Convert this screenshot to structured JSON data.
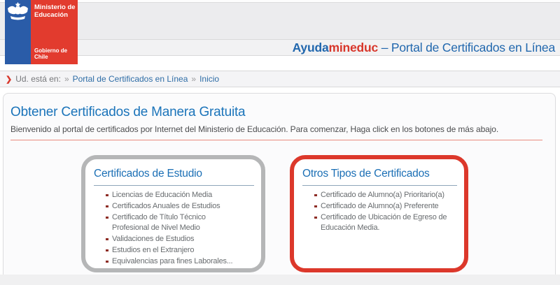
{
  "logo": {
    "ministry": "Ministerio de\nEducación",
    "government": "Gobierno de Chile",
    "blue_color": "#2a5ca8",
    "red_color": "#e23b2e"
  },
  "header": {
    "brand_blue": "Ayuda",
    "brand_red": "mineduc",
    "title_rest": " – Portal de Certificados en Línea"
  },
  "breadcrumb": {
    "chevron": "❯",
    "prefix": "Ud. está en:",
    "sep1": "»",
    "link1": "Portal de Certificados en Línea",
    "sep2": "»",
    "link2": "Inicio"
  },
  "main": {
    "title": "Obtener Certificados de Manera Gratuita",
    "intro": "Bienvenido al portal de certificados por Internet del Ministerio de Educación. Para comenzar, Haga click en los botones de más abajo.",
    "boxes": [
      {
        "title": "Certificados de Estudio",
        "border_color": "#b5b6b7",
        "items": [
          "Licencias de Educación Media",
          "Certificados Anuales de Estudios",
          "Certificado de Título Técnico\nProfesional de Nivel Medio",
          "Validaciones de Estudios",
          "Estudios en el Extranjero",
          "Equivalencias para fines Laborales..."
        ]
      },
      {
        "title": "Otros Tipos de Certificados",
        "border_color": "#dc382b",
        "items": [
          "Certificado de Alumno(a) Prioritario(a)",
          "Certificado de Alumno(a) Preferente",
          "Certificado de Ubicación de Egreso de\nEducación Media."
        ]
      }
    ]
  },
  "colors": {
    "heading_blue": "#1b74ba",
    "brand_red": "#d8372b",
    "separator_red": "#ea8a7e",
    "bullet_maroon": "#8e2d26",
    "band_gray": "#ececee",
    "footer_gray": "#f0f0f1"
  }
}
